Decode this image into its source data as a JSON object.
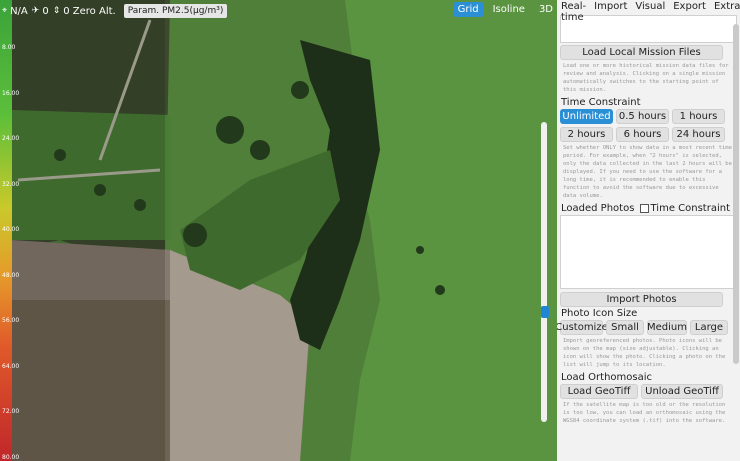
{
  "map": {
    "topbar": {
      "location": "N/A",
      "count": "0",
      "zero_alt": "0 Zero Alt.",
      "param_label": "Param.",
      "param_value": "PM2.5(µg/m³)"
    },
    "view_tabs": [
      {
        "label": "Grid",
        "active": true
      },
      {
        "label": "Isoline",
        "active": false
      },
      {
        "label": "3D",
        "active": false
      }
    ],
    "scale_labels": [
      "8.00",
      "16.00",
      "24.00",
      "32.00",
      "40.00",
      "48.00",
      "56.00",
      "64.00",
      "72.00",
      "80.00"
    ]
  },
  "panel": {
    "menu": [
      "Real-time",
      "Import",
      "Visual",
      "Export",
      "Extras"
    ],
    "load_mission_label": "Load Local Mission Files",
    "load_mission_desc": "Load one or more historical mission data files for review and analysis. Clicking on a single mission automatically switches to the starting point of this mission.",
    "time_constraint_title": "Time Constraint",
    "time_buttons": [
      {
        "label": "Unlimited",
        "active": true
      },
      {
        "label": "0.5 hours",
        "active": false
      },
      {
        "label": "1 hours",
        "active": false
      },
      {
        "label": "2 hours",
        "active": false
      },
      {
        "label": "6 hours",
        "active": false
      },
      {
        "label": "24 hours",
        "active": false
      }
    ],
    "time_desc": "Set whether ONLY to show data in a most recent time period. For example, when \"2 hours\" is selected, only the data collected in the last 2 hours will be displayed. If you need to use the software for a long time, it is recommended to enable this function to avoid the software due to excessive data volume.",
    "loaded_photos_title": "Loaded Photos",
    "photo_time_constraint_label": "Time Constraint",
    "import_photos_label": "Import Photos",
    "photo_icon_size_title": "Photo Icon Size",
    "icon_size_buttons": [
      "Customize",
      "Small",
      "Medium",
      "Large"
    ],
    "photo_desc": "Import georeferenced photos. Photo icons will be shown on the map (size adjustable). Clicking an icon will show the photo. Clicking a photo on the list will jump to its location.",
    "ortho_title": "Load Orthomosaic",
    "load_geotiff_label": "Load GeoTiff",
    "unload_geotiff_label": "Unload GeoTiff",
    "ortho_desc": "If the satellite map is too old or the resolution is too low, you can load an orthomosaic using the WGS84 coordinate system (.tif) into the software."
  }
}
